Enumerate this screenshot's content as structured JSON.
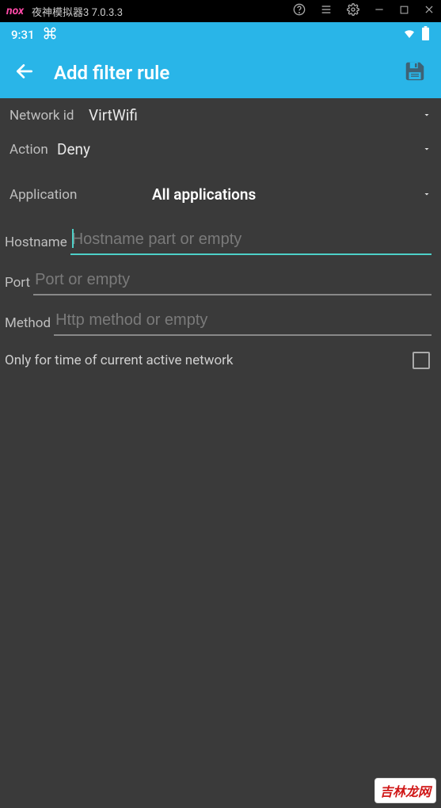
{
  "window": {
    "logo": "nox",
    "title": "夜神模拟器3 7.0.3.3"
  },
  "statusBar": {
    "time": "9:31"
  },
  "appBar": {
    "title": "Add filter rule"
  },
  "form": {
    "networkId": {
      "label": "Network id",
      "value": "VirtWifi"
    },
    "action": {
      "label": "Action",
      "value": "Deny"
    },
    "application": {
      "label": "Application",
      "value": "All applications"
    },
    "hostname": {
      "label": "Hostname",
      "placeholder": "Hostname part or empty",
      "value": ""
    },
    "port": {
      "label": "Port",
      "placeholder": "Port or empty",
      "value": ""
    },
    "method": {
      "label": "Method",
      "placeholder": "Http method or empty",
      "value": ""
    },
    "onlyCurrent": {
      "label": "Only for time of current active network",
      "checked": false
    }
  },
  "watermark": "吉林龙网"
}
